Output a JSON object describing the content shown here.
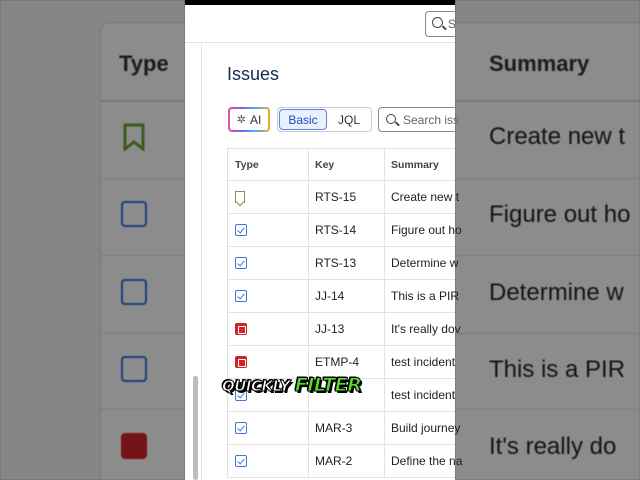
{
  "header": {
    "search_placeholder": "S"
  },
  "page": {
    "title": "Issues"
  },
  "toolbar": {
    "ai_label": "AI",
    "basic_label": "Basic",
    "jql_label": "JQL",
    "search_placeholder": "Search iss"
  },
  "table": {
    "columns": [
      "Type",
      "Key",
      "Summary"
    ],
    "rows": [
      {
        "type": "story-icon",
        "key": "RTS-15",
        "summary": "Create new t"
      },
      {
        "type": "task-icon",
        "key": "RTS-14",
        "summary": "Figure out ho"
      },
      {
        "type": "task-icon",
        "key": "RTS-13",
        "summary": "Determine w"
      },
      {
        "type": "task-icon",
        "key": "JJ-14",
        "summary": "This is a PIR"
      },
      {
        "type": "incident-icon",
        "key": "JJ-13",
        "summary": "It's really dov"
      },
      {
        "type": "incident-icon",
        "key": "ETMP-4",
        "summary": "test incident"
      },
      {
        "type": "task-icon",
        "key": "",
        "summary": "test incident"
      },
      {
        "type": "task-icon",
        "key": "MAR-3",
        "summary": "Build journey"
      },
      {
        "type": "task-icon",
        "key": "MAR-2",
        "summary": "Define the na"
      }
    ]
  },
  "overlay": {
    "word1": "QUICKLY",
    "word2": "FILTER"
  },
  "background_left": {
    "header": "Type"
  },
  "background_right": {
    "header": "Summary",
    "rows": [
      "Create new t",
      "Figure out ho",
      "Determine w",
      "This is a PIR",
      "It's really do"
    ]
  },
  "colors": {
    "task": "#3a78d6",
    "story": "#6aa33a",
    "incident": "#d2222a",
    "accent": "#1d4fb3",
    "filter_text": "#57e02a"
  }
}
